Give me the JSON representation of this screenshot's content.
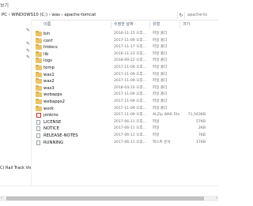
{
  "top": {
    "title": "보기"
  },
  "address": {
    "breadcrumb": "PC  ›  WINDOWS10 (C:)  ›  was  ›  apache-tomcat",
    "refresh_icon": "refresh-icon",
    "search_placeholder": "apache-to"
  },
  "sidebar": {
    "label": "C) Rail Track Vie"
  },
  "columns": {
    "name": "이름",
    "date": "수정한 날짜",
    "type": "유형",
    "size": "크기"
  },
  "files": [
    {
      "name": "bin",
      "date": "2016-11-15 오후...",
      "type": "파일 폴더",
      "size": "",
      "kind": "folder"
    },
    {
      "name": "conf",
      "date": "2017-11-09 오후...",
      "type": "파일 폴더",
      "size": "",
      "kind": "folder"
    },
    {
      "name": "htdocs",
      "date": "2017-11-17 오후...",
      "type": "파일 폴더",
      "size": "",
      "kind": "folder"
    },
    {
      "name": "lib",
      "date": "2016-11-23 오후...",
      "type": "파일 폴더",
      "size": "",
      "kind": "folder"
    },
    {
      "name": "logs",
      "date": "2018-09-22 오후...",
      "type": "파일 폴더",
      "size": "",
      "kind": "folder"
    },
    {
      "name": "temp",
      "date": "2017-11-09 오후...",
      "type": "파일 폴더",
      "size": "",
      "kind": "folder"
    },
    {
      "name": "was1",
      "date": "2017-11-09 오후...",
      "type": "파일 폴더",
      "size": "",
      "kind": "folder"
    },
    {
      "name": "was2",
      "date": "2017-11-09 오후...",
      "type": "파일 폴더",
      "size": "",
      "kind": "folder"
    },
    {
      "name": "was3",
      "date": "2018-04-10 오후...",
      "type": "파일 폴더",
      "size": "",
      "kind": "folder"
    },
    {
      "name": "webapps",
      "date": "2017-11-09 오후...",
      "type": "파일 폴더",
      "size": "",
      "kind": "folder"
    },
    {
      "name": "webapps2",
      "date": "2017-11-09 오후...",
      "type": "파일 폴더",
      "size": "",
      "kind": "folder"
    },
    {
      "name": "work",
      "date": "2017-11-09 오후...",
      "type": "파일 폴더",
      "size": "",
      "kind": "folder"
    },
    {
      "name": "jenkins",
      "date": "2017-11-09 오후...",
      "type": "ALZip WAR File",
      "size": "71,563KB",
      "kind": "jar"
    },
    {
      "name": "LICENSE",
      "date": "2017-06-11 오후...",
      "type": "파일",
      "size": "57KB",
      "kind": "file"
    },
    {
      "name": "NOTICE",
      "date": "2017-06-11 오후...",
      "type": "파일",
      "size": "2KB",
      "kind": "file"
    },
    {
      "name": "RELEASE-NOTES",
      "date": "2017-06-11 오후...",
      "type": "파일",
      "size": "7KB",
      "kind": "file"
    },
    {
      "name": "RUNNING",
      "date": "2017-06-11 오후...",
      "type": "텍스트 문서",
      "size": "17KB",
      "kind": "file"
    }
  ]
}
